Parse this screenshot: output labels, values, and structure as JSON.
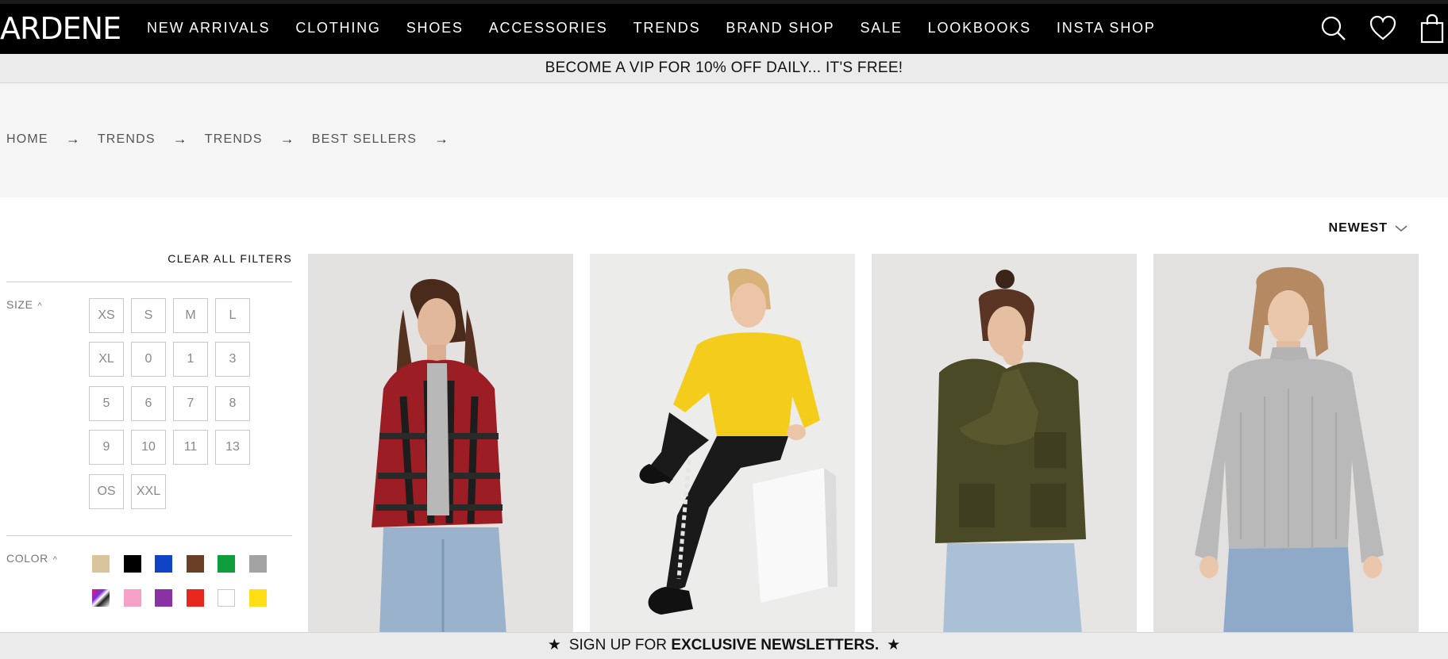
{
  "brand": {
    "logo": "ARDENE"
  },
  "nav": {
    "items": [
      "NEW ARRIVALS",
      "CLOTHING",
      "SHOES",
      "ACCESSORIES",
      "TRENDS",
      "BRAND SHOP",
      "SALE",
      "LOOKBOOKS",
      "INSTA SHOP"
    ],
    "icons": [
      "search-icon",
      "heart-icon",
      "shopping-bag-icon"
    ]
  },
  "promo": {
    "text": "BECOME A VIP FOR 10% OFF DAILY... IT'S FREE!"
  },
  "breadcrumb": [
    "HOME",
    "TRENDS",
    "TRENDS",
    "BEST SELLERS"
  ],
  "breadcrumb_separator": "→",
  "sort": {
    "label": "NEWEST"
  },
  "filters": {
    "clear_all": "CLEAR ALL FILTERS",
    "size": {
      "label": "SIZE",
      "options": [
        "XS",
        "S",
        "M",
        "L",
        "XL",
        "0",
        "1",
        "3",
        "5",
        "6",
        "7",
        "8",
        "9",
        "10",
        "11",
        "13",
        "OS",
        "XXL"
      ]
    },
    "color": {
      "label": "COLOR",
      "swatches": [
        {
          "name": "beige",
          "hex": "#d9c49c"
        },
        {
          "name": "black",
          "hex": "#000000"
        },
        {
          "name": "blue",
          "hex": "#1144c4"
        },
        {
          "name": "brown",
          "hex": "#6b3e26"
        },
        {
          "name": "green",
          "hex": "#0f9e3c"
        },
        {
          "name": "grey",
          "hex": "#a3a3a3"
        },
        {
          "name": "multi",
          "hex": "multicolor"
        },
        {
          "name": "pink",
          "hex": "#f6a0c8"
        },
        {
          "name": "purple",
          "hex": "#8a31a6"
        },
        {
          "name": "red",
          "hex": "#e5271e"
        },
        {
          "name": "white",
          "hex": "#ffffff"
        },
        {
          "name": "yellow",
          "hex": "#ffde15"
        }
      ]
    }
  },
  "products": [
    {
      "name": "plaid-hooded-shirt",
      "bg": "#e3e2e1"
    },
    {
      "name": "yellow-top-black-leggings",
      "bg": "#ececeb"
    },
    {
      "name": "olive-utility-jacket",
      "bg": "#e6e5e3"
    },
    {
      "name": "grey-knit-sweater",
      "bg": "#e2e1df"
    }
  ],
  "newsletter": {
    "prefix": "SIGN UP FOR ",
    "bold": "EXCLUSIVE NEWSLETTERS."
  }
}
